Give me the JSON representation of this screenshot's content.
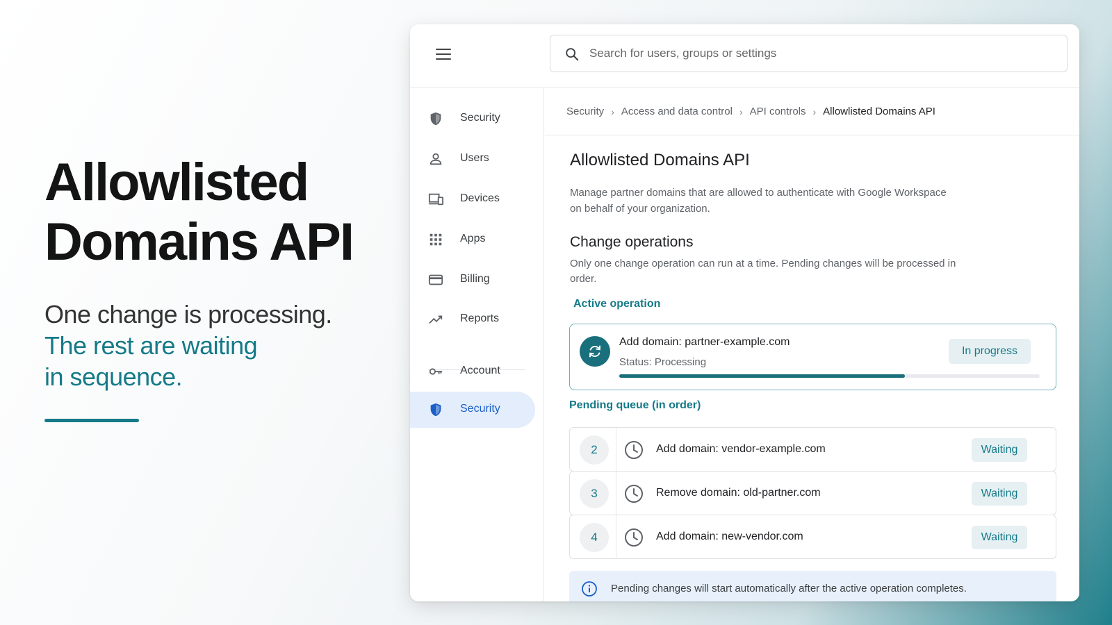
{
  "hero": {
    "title_line1": "Allowlisted",
    "title_line2": "Domains API",
    "line1": "One change is processing.",
    "line2": "The rest are waiting",
    "line3": "in sequence."
  },
  "search": {
    "placeholder": "Search for users, groups or settings",
    "value": ""
  },
  "sidebar": {
    "items": [
      {
        "label": "Security",
        "icon": "shield-icon"
      },
      {
        "label": "Users",
        "icon": "person-icon"
      },
      {
        "label": "Devices",
        "icon": "devices-icon"
      },
      {
        "label": "Apps",
        "icon": "apps-grid-icon"
      },
      {
        "label": "Billing",
        "icon": "credit-card-icon"
      },
      {
        "label": "Reports",
        "icon": "trending-icon"
      },
      {
        "label": "Account",
        "icon": "key-icon"
      },
      {
        "label": "Security",
        "icon": "shield-icon",
        "active": true
      }
    ]
  },
  "breadcrumb": [
    "Security",
    "Access and data control",
    "API controls",
    "Allowlisted Domains API"
  ],
  "page": {
    "title": "Allowlisted Domains API",
    "description": "Manage partner domains that are allowed to authenticate with Google Workspace on behalf of your organization.",
    "section_title": "Change operations",
    "section_description": "Only one change operation can run at a time. Pending changes will be processed in order."
  },
  "active_operation": {
    "label": "Active operation",
    "title": "Add domain: partner-example.com",
    "status": "Status: Processing",
    "badge": "In progress",
    "progress": 0.68
  },
  "pending": {
    "label": "Pending queue (in order)",
    "items": [
      {
        "num": "2",
        "text": "Add domain: vendor-example.com",
        "badge": "Waiting"
      },
      {
        "num": "3",
        "text": "Remove domain: old-partner.com",
        "badge": "Waiting"
      },
      {
        "num": "4",
        "text": "Add domain: new-vendor.com",
        "badge": "Waiting"
      }
    ]
  },
  "info": {
    "text": "Pending changes will start automatically after the active operation completes."
  },
  "colors": {
    "accent": "#157a88",
    "active_nav": "#1a5fc8",
    "active_nav_bg": "#e3edfb"
  }
}
